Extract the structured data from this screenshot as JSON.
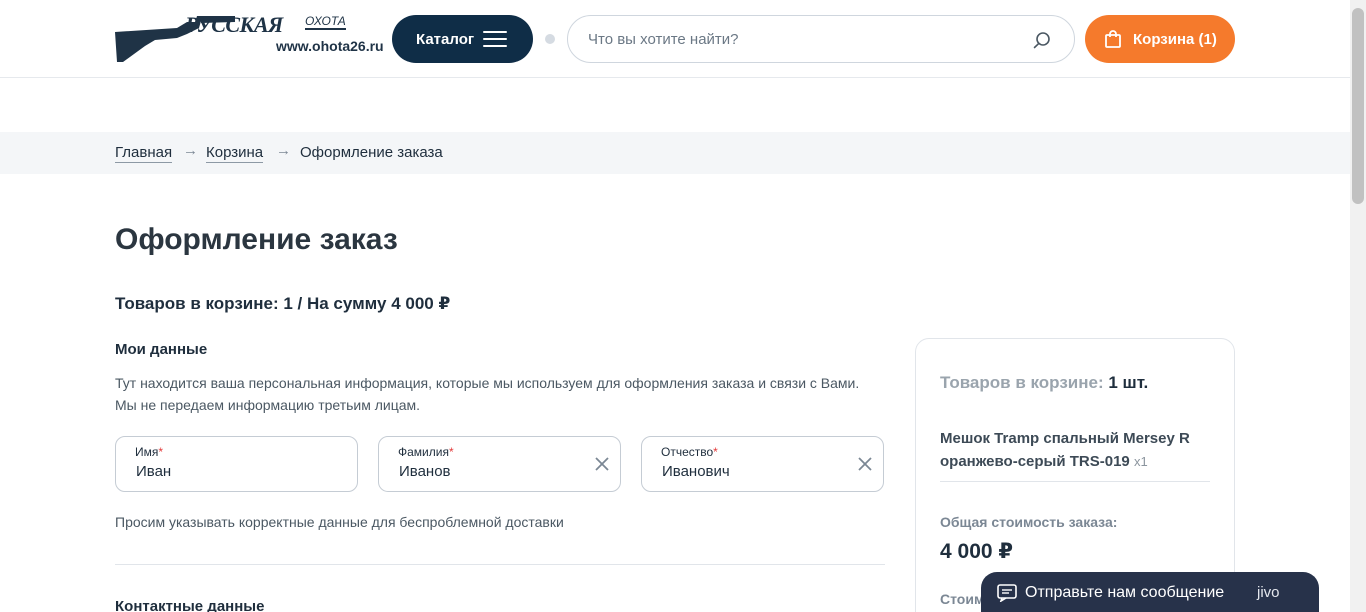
{
  "header": {
    "logo": {
      "brand": "РУССКАЯ",
      "brand_sub": "ОХОТА",
      "url": "www.ohota26.ru"
    },
    "catalog_label": "Каталог",
    "search_placeholder": "Что вы хотите найти?",
    "cart_label": "Корзина (1)"
  },
  "breadcrumb": {
    "home": "Главная",
    "cart": "Корзина",
    "current": "Оформление заказа",
    "separator": "→"
  },
  "main": {
    "title": "Оформление заказ",
    "summary": "Товаров в корзине: 1 / На сумму 4 000 ₽",
    "my_data_title": "Мои данные",
    "my_data_note_1": "Тут находится ваша персональная информация, которые мы используем для оформления заказа и связи с Вами.",
    "my_data_note_2": "Мы не передаем информацию третьим лицам.",
    "fields": [
      {
        "label": "Имя",
        "required": "*",
        "value": "Иван"
      },
      {
        "label": "Фамилия",
        "required": "*",
        "value": "Иванов"
      },
      {
        "label": "Отчество",
        "required": "*",
        "value": "Иванович"
      }
    ],
    "hint": "Просим указывать корректные данные для беспроблемной доставки",
    "contacts_title": "Контактные данные"
  },
  "side": {
    "count_label": "Товаров в корзине:",
    "count_value": "1 шт.",
    "product_name": "Мешок Tramp спальный Mersey R оранжево-серый TRS-019",
    "product_qty": "x1",
    "total_label": "Общая стоимость заказа:",
    "total_value": "4 000 ₽",
    "partial_label": "Стоим"
  },
  "chat": {
    "text": "Отправьте нам сообщение",
    "brand": "jivo"
  },
  "colors": {
    "navy": "#0f2d47",
    "orange": "#f57a2c",
    "required": "#e33a3a"
  }
}
